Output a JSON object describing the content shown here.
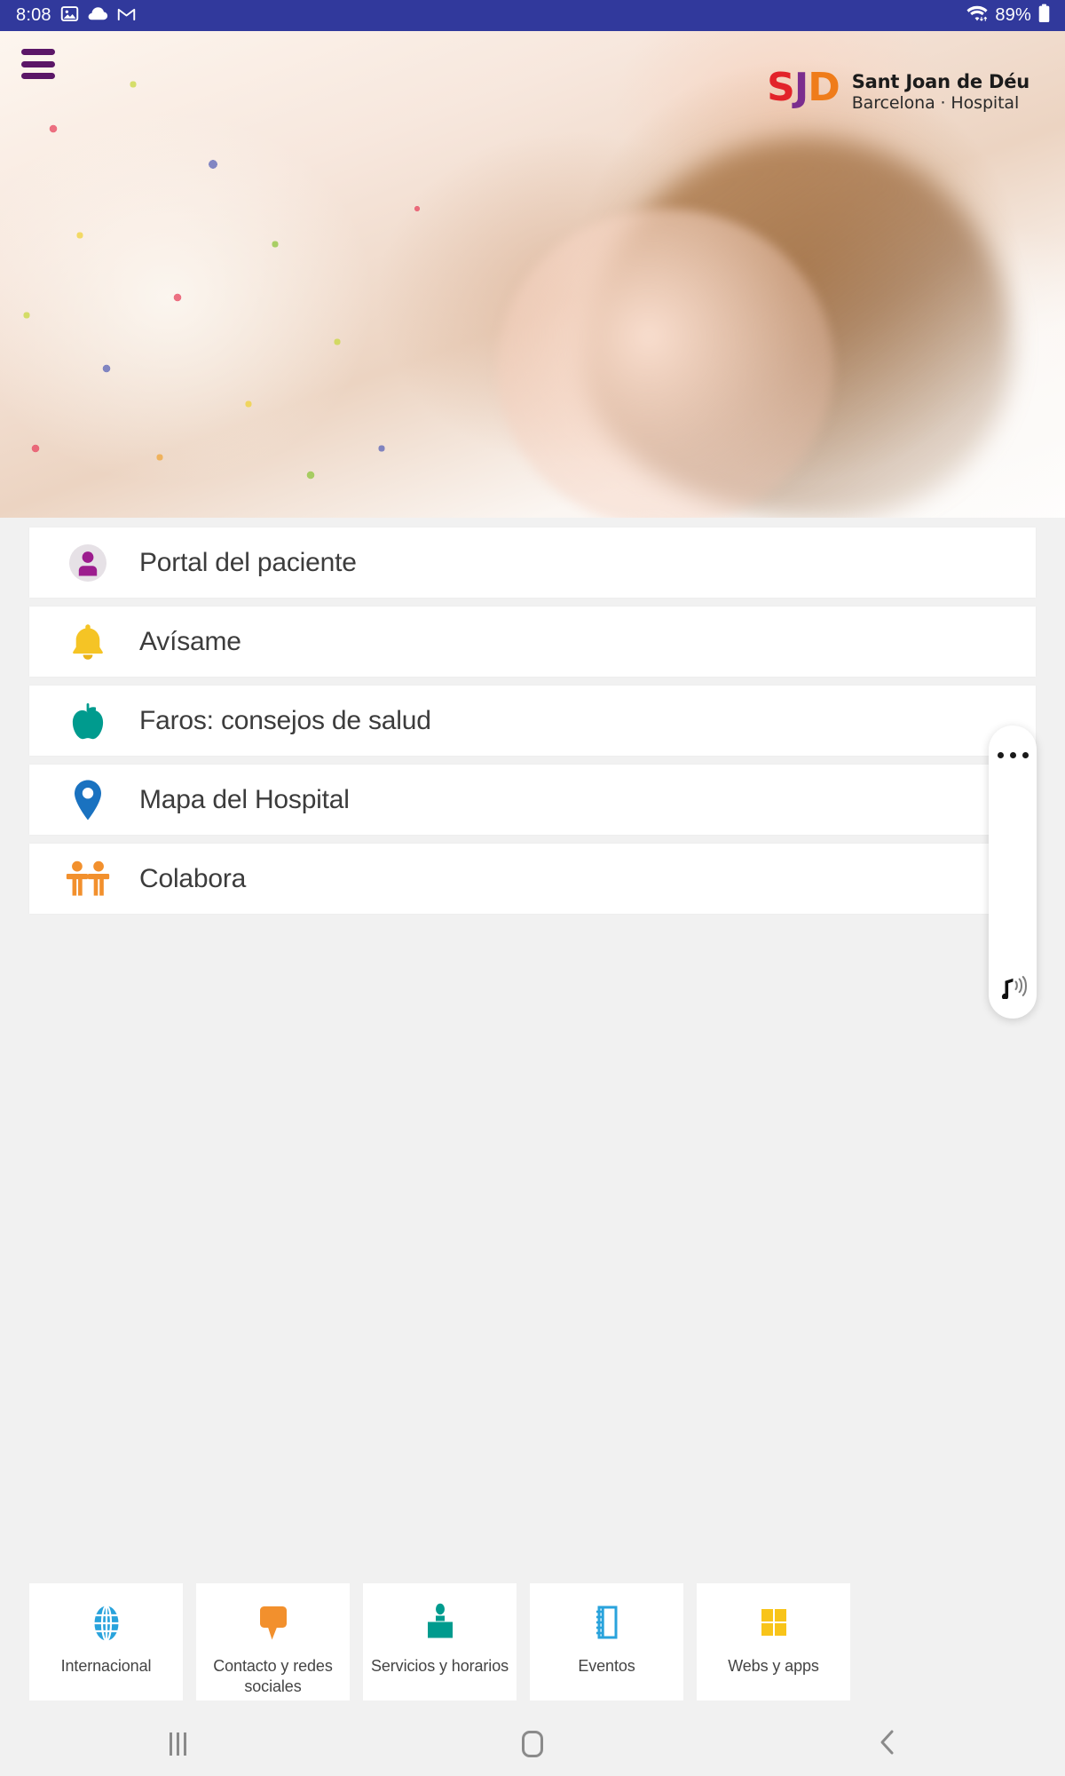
{
  "status_bar": {
    "time": "8:08",
    "battery_percent": "89%",
    "left_icons": [
      "photos-icon",
      "cloud-icon",
      "gmail-icon"
    ],
    "right_icons": [
      "wifi-icon",
      "battery-icon"
    ],
    "background_color": "#31399c"
  },
  "header": {
    "menu_icon": "hamburger-menu-icon",
    "menu_color": "#5b1667",
    "logo": {
      "mark_letters": [
        "S",
        "J",
        "D"
      ],
      "mark_colors": [
        "#e2232a",
        "#7b2d8e",
        "#ef7c1a"
      ],
      "name": "Sant Joan de Déu",
      "subtitle": "Barcelona · Hospital"
    },
    "hero_image": "child-lying-on-bed-photo"
  },
  "menu": {
    "items": [
      {
        "label": "Portal del paciente",
        "icon": "patient-avatar-icon",
        "color": "#9c1d8e"
      },
      {
        "label": "Avísame",
        "icon": "bell-icon",
        "color": "#f5c425"
      },
      {
        "label": "Faros: consejos de salud",
        "icon": "apple-icon",
        "color": "#009b8e"
      },
      {
        "label": "Mapa del Hospital",
        "icon": "map-pin-icon",
        "color": "#1a72c0"
      },
      {
        "label": "Colabora",
        "icon": "two-people-icon",
        "color": "#f2902d"
      }
    ]
  },
  "edge_panel": {
    "handle_icon": "more-dots-icon",
    "sound_icon": "music-note-icon"
  },
  "tiles": [
    {
      "label": "Internacional",
      "icon": "globe-icon",
      "color": "#29a3dc"
    },
    {
      "label": "Contacto y redes sociales",
      "icon": "speech-bubble-icon",
      "color": "#f2902d"
    },
    {
      "label": "Servicios y horarios",
      "icon": "reception-desk-icon",
      "color": "#009b8e"
    },
    {
      "label": "Eventos",
      "icon": "notebook-icon",
      "color": "#29a3dc"
    },
    {
      "label": "Webs y apps",
      "icon": "grid-squares-icon",
      "color": "#f8c419"
    }
  ],
  "navbar": {
    "recents_icon": "recents-icon",
    "home_icon": "home-icon",
    "back_icon": "back-chevron-icon"
  }
}
